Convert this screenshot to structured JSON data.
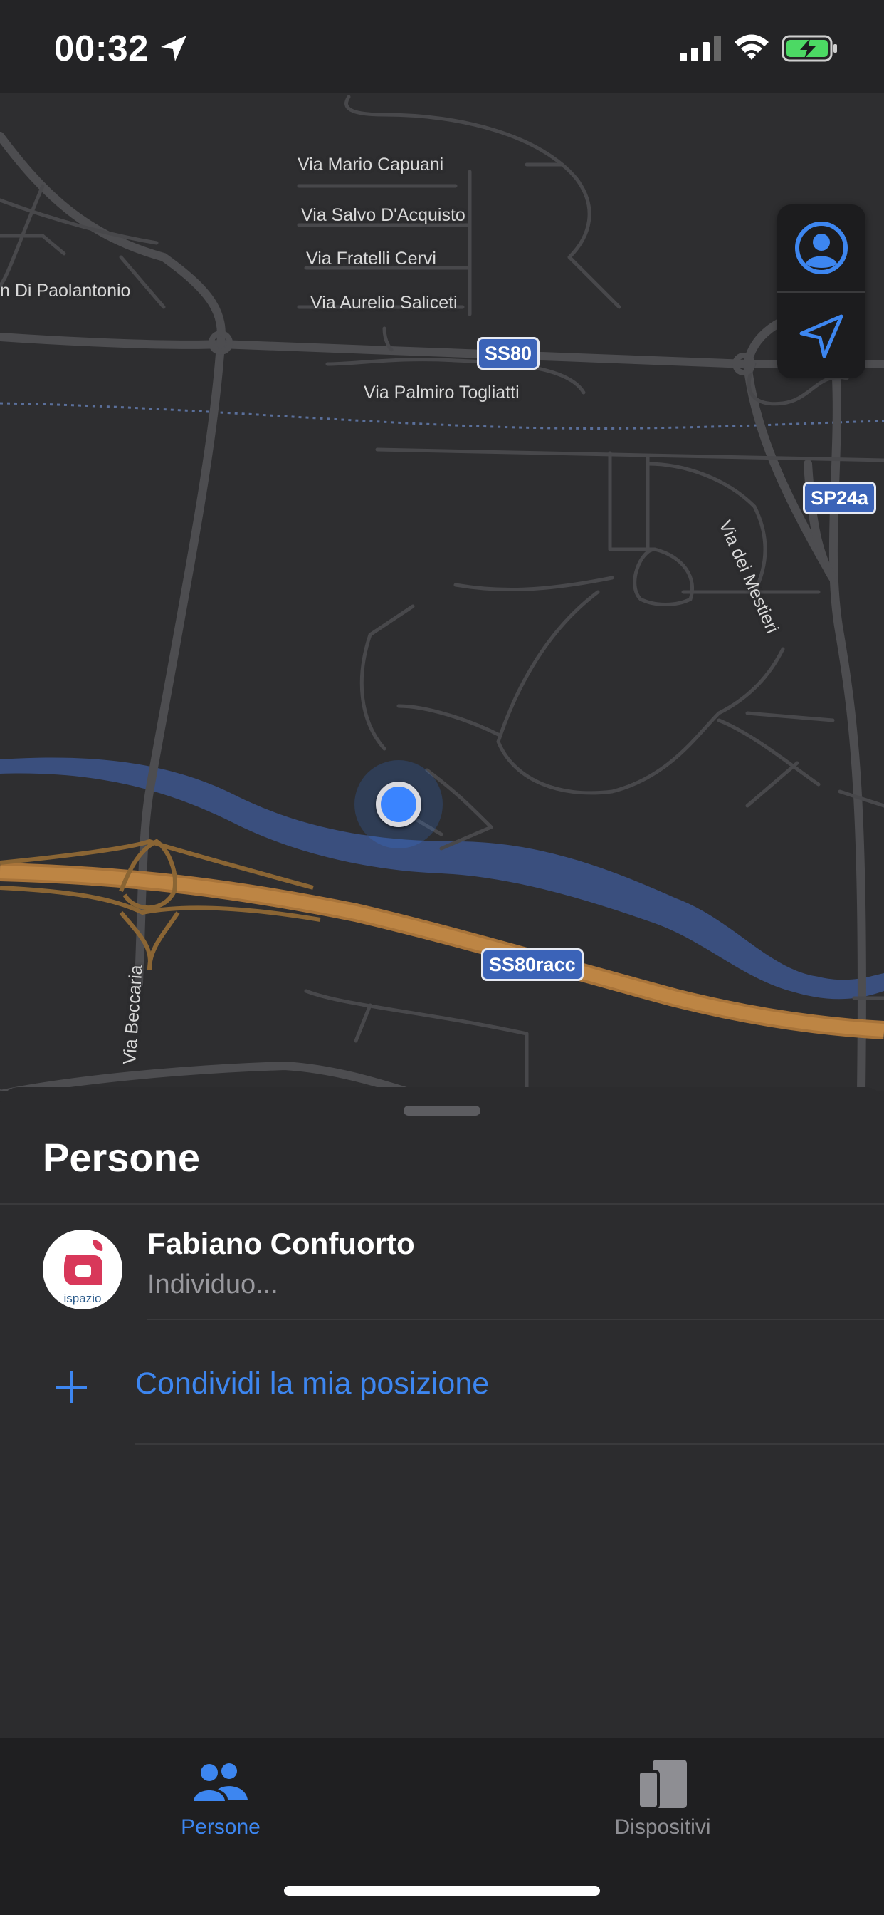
{
  "status_bar": {
    "time": "00:32",
    "icons": [
      "location-arrow-icon",
      "cellular-signal-icon",
      "wifi-icon",
      "battery-charging-icon"
    ]
  },
  "map": {
    "street_labels": [
      "Via Mario Capuani",
      "Via Salvo D'Acquisto",
      "Via Fratelli Cervi",
      "Via Aurelio Saliceti",
      "n Di Paolantonio",
      "Via Palmiro Togliatti",
      "Via dei Mestieri",
      "Via Beccaria"
    ],
    "road_shields": [
      "SS80",
      "SP24a",
      "SS80racc"
    ],
    "controls": {
      "account_icon": "person-circle-icon",
      "locate_icon": "location-arrow-icon"
    },
    "colors": {
      "background": "#2e2e30",
      "road": "#4a4a4d",
      "river": "#3a4f7e",
      "highway": "#b07a3a",
      "user_dot": "#3a84ff",
      "shield": "#3b63b8"
    }
  },
  "sheet": {
    "title": "Persone",
    "people": [
      {
        "name": "Fabiano Confuorto",
        "status": "Individuo...",
        "avatar_text": "ispazio"
      }
    ],
    "share_label": "Condividi la mia posizione"
  },
  "tab_bar": {
    "tabs": [
      {
        "label": "Persone",
        "icon": "people-icon",
        "selected": true
      },
      {
        "label": "Dispositivi",
        "icon": "devices-icon",
        "selected": false
      }
    ],
    "accent": "#3d86f0"
  }
}
